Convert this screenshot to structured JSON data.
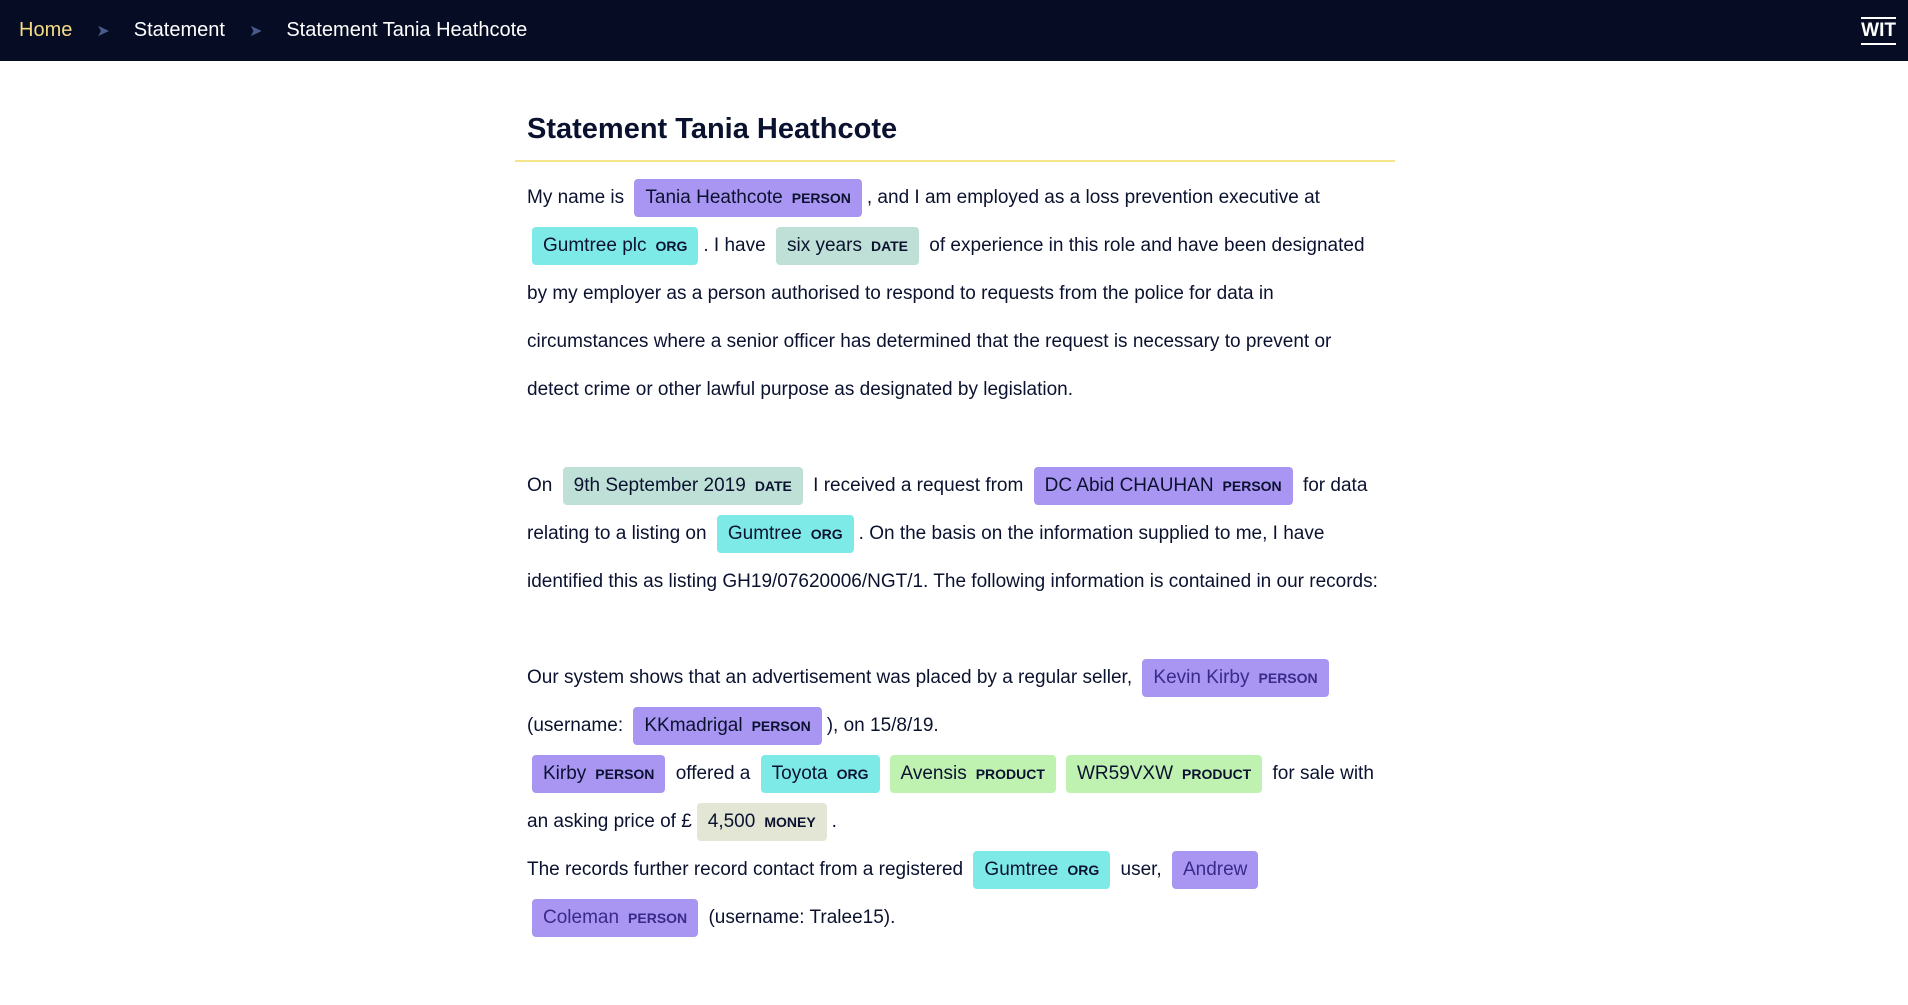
{
  "breadcrumb": {
    "home": "Home",
    "statement": "Statement",
    "current": "Statement Tania Heathcote"
  },
  "logo": {
    "text": "WIT"
  },
  "page": {
    "title": "Statement Tania Heathcote"
  },
  "colors": {
    "PERSON": "#a996f3",
    "ORG": "#7eeae8",
    "DATE": "#bfe0d6",
    "PRODUCT": "#bff2b1",
    "MONEY": "#e3e6d4"
  },
  "p1": {
    "t1": "My name is ",
    "e1": {
      "text": "Tania Heathcote",
      "label": "PERSON"
    },
    "t2": ", and I am employed as a loss prevention executive at ",
    "e2": {
      "text": "Gumtree plc",
      "label": "ORG"
    },
    "t3": ". I have ",
    "e3": {
      "text": "six years",
      "label": "DATE"
    },
    "t4": " of experience in this role and have been designated by my employer as a person authorised to respond to requests from the police for data in circumstances where a senior officer has determined that the request is necessary to prevent or detect crime or other lawful purpose as designated by legislation."
  },
  "p2": {
    "t1": "On ",
    "e1": {
      "text": "9th September 2019",
      "label": "DATE"
    },
    "t2": " I received a request from ",
    "e2": {
      "text": "DC Abid CHAUHAN",
      "label": "PERSON"
    },
    "t3": " for data relating to a listing on ",
    "e3": {
      "text": "Gumtree",
      "label": "ORG"
    },
    "t4": ". On the basis on the information supplied to me, I have identified this as listing GH19/07620006/NGT/1. The following information is contained in our records:"
  },
  "p3": {
    "t1": "Our system shows that an advertisement was placed by a regular seller, ",
    "e1": {
      "text": "Kevin Kirby",
      "label": "PERSON"
    },
    "t2": " (username: ",
    "e2": {
      "text": "KKmadrigal",
      "label": "PERSON"
    },
    "t3": "), on 15/8/19."
  },
  "p4": {
    "e1": {
      "text": "Kirby",
      "label": "PERSON"
    },
    "t1": " offered a ",
    "e2": {
      "text": "Toyota",
      "label": "ORG"
    },
    "e3": {
      "text": "Avensis",
      "label": "PRODUCT"
    },
    "e4": {
      "text": "WR59VXW",
      "label": "PRODUCT"
    },
    "t2": " for sale with an asking price of £",
    "e5": {
      "text": "4,500",
      "label": "MONEY"
    },
    "t3": "."
  },
  "p5": {
    "t1": "The records further record contact from a registered ",
    "e1": {
      "text": "Gumtree",
      "label": "ORG"
    },
    "t2": " user, ",
    "e2": {
      "text": "Andrew",
      "label": "PERSON"
    },
    "e3": {
      "text": "Coleman",
      "label": "PERSON"
    },
    "t3": " (username: Tralee15)."
  }
}
